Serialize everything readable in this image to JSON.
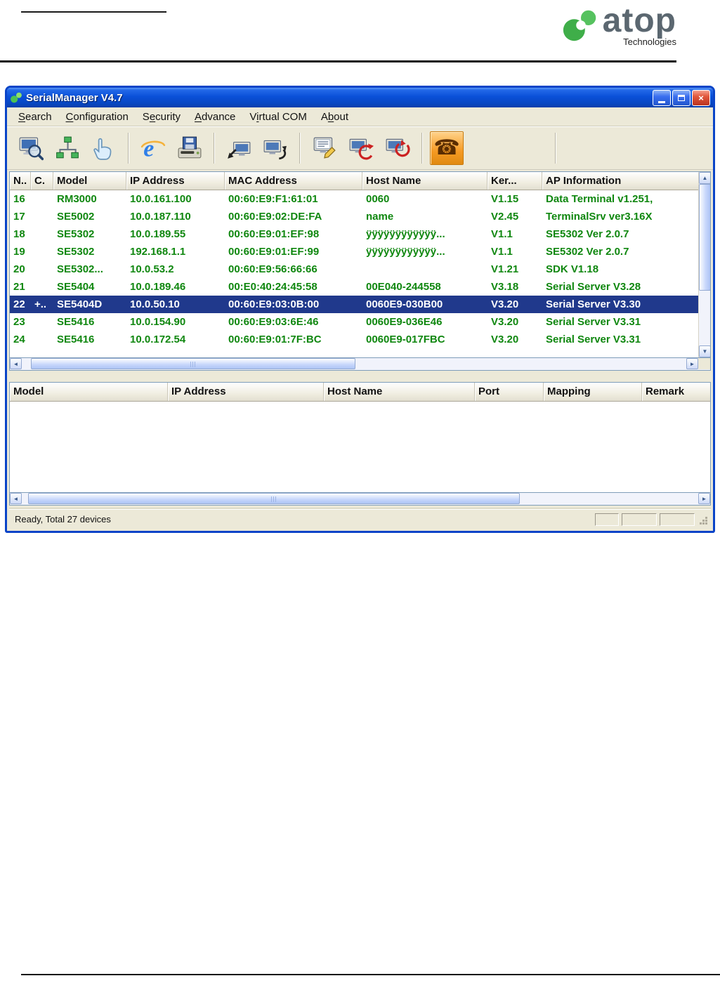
{
  "header": {
    "logo_text": "atop",
    "logo_sub": "Technologies"
  },
  "colors": {
    "titlebar_blue": "#0a50d8",
    "window_frame_blue": "#0a44c8",
    "chrome_bg": "#ece9d8",
    "list_text_green": "#0f870f",
    "selected_row_bg": "#20398c",
    "selected_row_text": "#ffffff",
    "alert_button_orange": "#f59a23",
    "logo_green": "#3fae49"
  },
  "window": {
    "title": "SerialManager V4.7",
    "controls": {
      "minimize": "minimize",
      "maximize": "maximize",
      "close": "close"
    },
    "menus": [
      {
        "label": "Search",
        "accel": 0
      },
      {
        "label": "Configuration",
        "accel": 0
      },
      {
        "label": "Security",
        "accel": 1
      },
      {
        "label": "Advance",
        "accel": 0
      },
      {
        "label": "Virtual COM",
        "accel": 1
      },
      {
        "label": "About",
        "accel": 1
      }
    ],
    "toolbar": [
      {
        "name": "search-device"
      },
      {
        "name": "search-network"
      },
      {
        "name": "locate"
      },
      {
        "name": "web-console",
        "sep_before": true
      },
      {
        "name": "save-firmware"
      },
      {
        "name": "import-setting",
        "sep_before": true
      },
      {
        "name": "export-setting"
      },
      {
        "name": "configure",
        "sep_before": true
      },
      {
        "name": "upgrade"
      },
      {
        "name": "reboot"
      },
      {
        "name": "alert",
        "sep_before": true,
        "highlight": true
      }
    ],
    "device_list": {
      "columns": [
        "N..",
        "C.",
        "Model",
        "IP Address",
        "MAC Address",
        "Host Name",
        "Ker...",
        "AP Information"
      ],
      "rows": [
        {
          "cells": [
            "16",
            "",
            "RM3000",
            "10.0.161.100",
            "00:60:E9:F1:61:01",
            "0060",
            "V1.15",
            "Data Terminal v1.251,"
          ],
          "selected": false
        },
        {
          "cells": [
            "17",
            "",
            "SE5002",
            "10.0.187.110",
            "00:60:E9:02:DE:FA",
            "name",
            "V2.45",
            "TerminalSrv ver3.16X"
          ],
          "selected": false
        },
        {
          "cells": [
            "18",
            "",
            "SE5302",
            "10.0.189.55",
            "00:60:E9:01:EF:98",
            "ÿÿÿÿÿÿÿÿÿÿÿÿ...",
            "V1.1",
            "SE5302 Ver 2.0.7"
          ],
          "selected": false
        },
        {
          "cells": [
            "19",
            "",
            "SE5302",
            "192.168.1.1",
            "00:60:E9:01:EF:99",
            "ÿÿÿÿÿÿÿÿÿÿÿÿ...",
            "V1.1",
            "SE5302 Ver 2.0.7"
          ],
          "selected": false
        },
        {
          "cells": [
            "20",
            "",
            "SE5302...",
            "10.0.53.2",
            "00:60:E9:56:66:66",
            "",
            "V1.21",
            "SDK V1.18"
          ],
          "selected": false
        },
        {
          "cells": [
            "21",
            "",
            "SE5404",
            "10.0.189.46",
            "00:E0:40:24:45:58",
            "00E040-244558",
            "V3.18",
            "Serial Server V3.28"
          ],
          "selected": false
        },
        {
          "cells": [
            "22",
            "+..",
            "SE5404D",
            "10.0.50.10",
            "00:60:E9:03:0B:00",
            "0060E9-030B00",
            "V3.20",
            "Serial Server V3.30"
          ],
          "selected": true
        },
        {
          "cells": [
            "23",
            "",
            "SE5416",
            "10.0.154.90",
            "00:60:E9:03:6E:46",
            "0060E9-036E46",
            "V3.20",
            "Serial Server V3.31"
          ],
          "selected": false
        },
        {
          "cells": [
            "24",
            "",
            "SE5416",
            "10.0.172.54",
            "00:60:E9:01:7F:BC",
            "0060E9-017FBC",
            "V3.20",
            "Serial Server V3.31"
          ],
          "selected": false
        }
      ]
    },
    "mapping_list": {
      "columns": [
        "Model",
        "IP Address",
        "Host Name",
        "Port",
        "Mapping",
        "Remark"
      ],
      "rows": []
    },
    "status_text": "Ready, Total 27 devices"
  }
}
